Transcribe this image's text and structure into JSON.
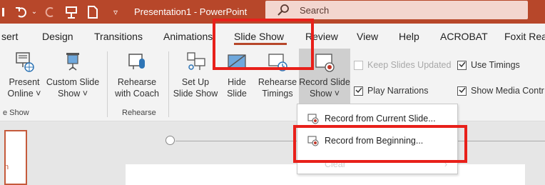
{
  "titlebar": {
    "title": "Presentation1 - PowerPoint",
    "search_placeholder": "Search",
    "icons": [
      "save-icon",
      "undo-icon",
      "redo-icon",
      "touch-mode-icon",
      "new-icon",
      "customize-qat-icon"
    ]
  },
  "tabs": [
    {
      "label": "sert"
    },
    {
      "label": "Design"
    },
    {
      "label": "Transitions"
    },
    {
      "label": "Animations"
    },
    {
      "label": "Slide Show"
    },
    {
      "label": "Review"
    },
    {
      "label": "View"
    },
    {
      "label": "Help"
    },
    {
      "label": "ACROBAT"
    },
    {
      "label": "Foxit Rea"
    }
  ],
  "ribbon": {
    "present_online": {
      "line1": "Present",
      "line2": "Online ˅"
    },
    "custom_slide_show": {
      "line1": "Custom Slide",
      "line2": "Show ˅"
    },
    "group_start": "e Show",
    "rehearse_with_coach": {
      "line1": "Rehearse",
      "line2": "with Coach"
    },
    "group_rehearse": "Rehearse",
    "set_up": {
      "line1": "Set Up",
      "line2": "Slide Show"
    },
    "hide_slide": {
      "line1": "Hide",
      "line2": "Slide"
    },
    "rehearse_timings": {
      "line1": "Rehearse",
      "line2": "Timings"
    },
    "record_slide_show": {
      "line1": "Record Slide",
      "line2": "Show ˅"
    },
    "checkboxes": {
      "keep_updated": {
        "label": "Keep Slides Updated",
        "checked": false,
        "disabled": true
      },
      "use_timings": {
        "label": "Use Timings",
        "checked": true
      },
      "play_narrations": {
        "label": "Play Narrations",
        "checked": true
      },
      "show_media_controls": {
        "label": "Show Media Contr",
        "checked": true
      }
    }
  },
  "dropdown": {
    "items": [
      {
        "label": "Record from Current Slide..."
      },
      {
        "label": "Record from Beginning..."
      },
      {
        "label": "Clear"
      }
    ]
  },
  "slide_pane": {
    "thumb_text": "n"
  },
  "colors": {
    "accent": "#b7472a",
    "annotation": "#e8201a"
  }
}
